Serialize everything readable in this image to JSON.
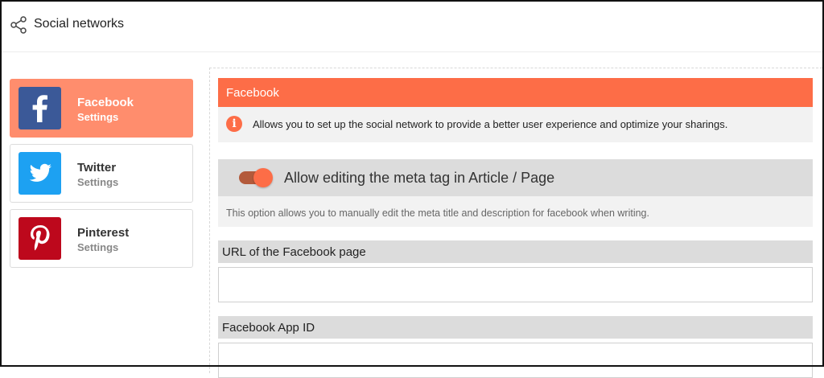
{
  "header": {
    "title": "Social networks",
    "icon": "share-icon"
  },
  "sidebar": {
    "items": [
      {
        "name": "Facebook",
        "sub": "Settings",
        "icon": "facebook-icon",
        "active": true
      },
      {
        "name": "Twitter",
        "sub": "Settings",
        "icon": "twitter-icon",
        "active": false
      },
      {
        "name": "Pinterest",
        "sub": "Settings",
        "icon": "pinterest-icon",
        "active": false
      }
    ]
  },
  "panel": {
    "title": "Facebook",
    "info": "Allows you to set up the social network to provide a better user experience and optimize your sharings.",
    "toggle": {
      "label": "Allow editing the meta tag in Article / Page",
      "description": "This option allows you to manually edit the meta title and description for facebook when writing.",
      "enabled": true
    },
    "fields": [
      {
        "label": "URL of the Facebook page",
        "value": "",
        "placeholder": ""
      },
      {
        "label": "Facebook App ID",
        "value": "",
        "placeholder": ""
      }
    ]
  },
  "colors": {
    "accent": "#fd6d47",
    "active_item": "#ff8d6d",
    "facebook": "#3b5998",
    "twitter": "#1da1f2",
    "pinterest": "#bd081c"
  }
}
